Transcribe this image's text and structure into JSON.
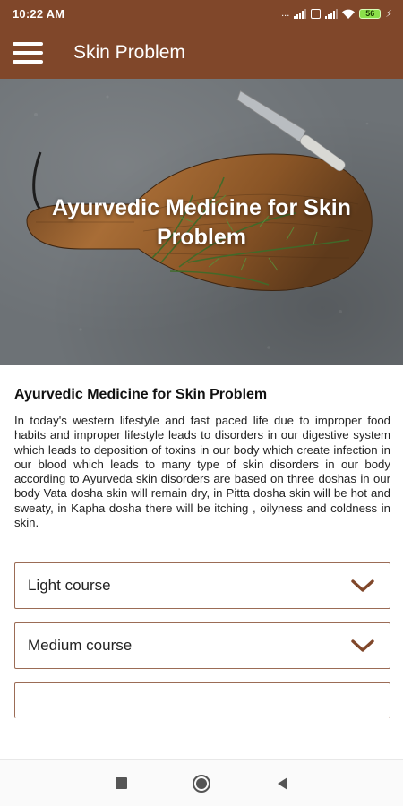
{
  "status_bar": {
    "time": "10:22 AM",
    "dots": "...",
    "battery": "56",
    "icons": [
      "signal-icon",
      "data-saver-icon",
      "signal-icon",
      "wifi-icon",
      "battery-icon",
      "charging-icon"
    ]
  },
  "app_bar": {
    "title": "Skin Problem",
    "menu_icon": "hamburger-menu-icon"
  },
  "hero": {
    "title": "Ayurvedic Medicine for Skin Problem"
  },
  "article": {
    "heading": "Ayurvedic Medicine for Skin Problem",
    "body": "In today's western lifestyle and fast paced life due to improper food habits and improper lifestyle leads to disorders in our digestive system which leads to deposition of toxins in our body which create infection in our blood which leads to many type of skin disorders in our body according to Ayurveda skin disorders are based on three doshas in our body Vata dosha  skin will remain dry, in Pitta dosha skin will be hot and sweaty, in Kapha dosha there will be itching , oilyness and coldness in skin."
  },
  "courses": [
    {
      "label": "Light course",
      "icon": "chevron-down-icon"
    },
    {
      "label": "Medium course",
      "icon": "chevron-down-icon"
    }
  ],
  "nav_bar": {
    "icons": [
      "recents-icon",
      "home-icon",
      "back-icon"
    ]
  },
  "colors": {
    "primary": "#80472a",
    "accordion_border": "#9b6c56",
    "chevron": "#80472a"
  }
}
